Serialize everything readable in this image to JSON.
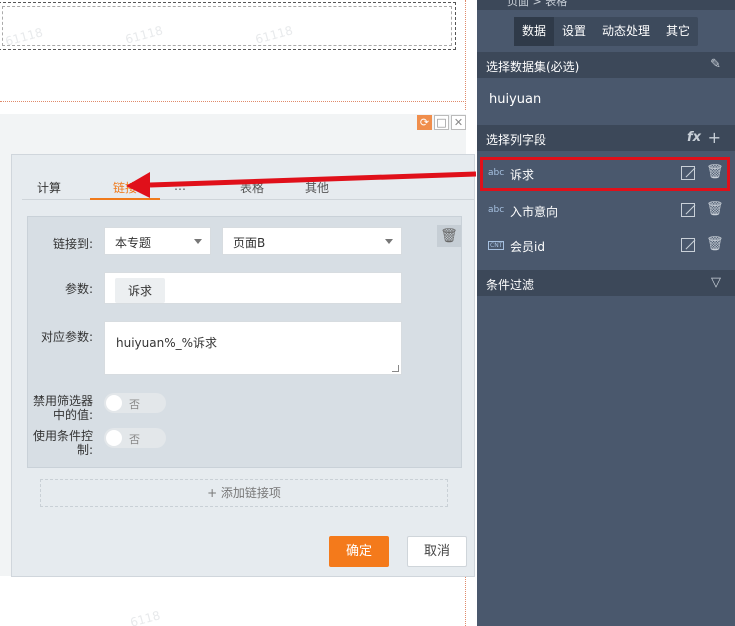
{
  "dialog": {
    "tabs": [
      {
        "label": "计算"
      },
      {
        "label": "链接"
      },
      {
        "label": "…"
      },
      {
        "label": "表格"
      },
      {
        "label": "其他"
      }
    ],
    "link_to_label": "链接到:",
    "link_to_topic": "本专题",
    "link_to_page": "页面B",
    "param_label": "参数:",
    "param_chip": "诉求",
    "mapped_label": "对应参数:",
    "mapped_value": "huiyuan%_%诉求",
    "disable_filter_label_1": "禁用筛选器",
    "disable_filter_label_2": "中的值:",
    "disable_filter_value": "否",
    "use_condition_label_1": "使用条件控",
    "use_condition_label_2": "制:",
    "use_condition_value": "否",
    "add_link": "+ 添加链接项",
    "ok": "确定",
    "cancel": "取消"
  },
  "right_panel": {
    "breadcrumb": "页面 > 表格",
    "tabs": [
      "数据",
      "设置",
      "动态处理",
      "其它"
    ],
    "select_dataset": "选择数据集(必选)",
    "dataset_name": "huiyuan",
    "select_fields": "选择列字段",
    "fields": [
      {
        "type": "abc",
        "name": "诉求"
      },
      {
        "type": "abc",
        "name": "入市意向"
      },
      {
        "type": "CNT",
        "name": "会员id"
      }
    ],
    "condition_filter": "条件过滤"
  },
  "watermarks": [
    "61118",
    "61118",
    "61118",
    "6118"
  ],
  "colors": {
    "accent": "#f47a1b",
    "panel_bg": "#4a586d",
    "highlight": "#e0101a"
  }
}
